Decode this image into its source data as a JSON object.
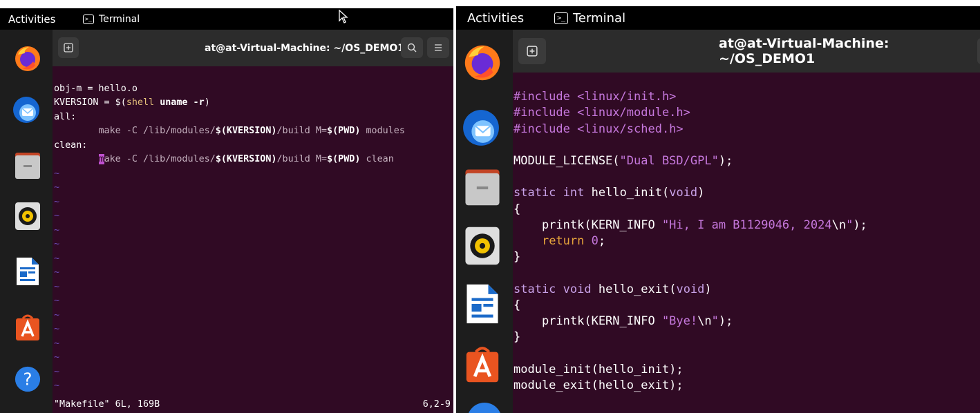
{
  "left_screenshot": {
    "topbar": {
      "activities": "Activities",
      "app": "Terminal"
    },
    "window": {
      "title": "at@at-Virtual-Machine: ~/OS_DEMO1",
      "new_tab_icon": "new-tab-icon",
      "search_icon": "search-icon",
      "menu_icon": "hamburger-menu-icon"
    },
    "dock": [
      "firefox-icon",
      "thunderbird-icon",
      "files-icon",
      "rhythmbox-icon",
      "writer-icon",
      "app-center-icon",
      "help-icon"
    ],
    "editor": {
      "line1": "obj-m = hello.o",
      "line2_a": "KVERSION = $(",
      "line2_b": "shell",
      "line2_c": " ",
      "line2_d": "uname -r",
      "line2_e": ")",
      "line3": "all:",
      "line4_a": "        make -C /lib/modules/",
      "line4_b": "$(KVERSION)",
      "line4_c": "/build M=",
      "line4_d": "$(PWD)",
      "line4_e": " modules",
      "line5": "clean:",
      "line6_a": "        ",
      "line6_cursor": "m",
      "line6_b": "ake -C /lib/modules/",
      "line6_c": "$(KVERSION)",
      "line6_d": "/build M=",
      "line6_e": "$(PWD)",
      "line6_f": " clean",
      "tilde": "~",
      "status_left": "\"Makefile\" 6L, 169B",
      "status_right": "6,2-9"
    }
  },
  "right_screenshot": {
    "topbar": {
      "activities": "Activities",
      "app": "Terminal"
    },
    "window": {
      "title": "at@at-Virtual-Machine: ~/OS_DEMO1",
      "new_tab_icon": "new-tab-icon"
    },
    "dock": [
      "firefox-icon",
      "thunderbird-icon",
      "files-icon",
      "rhythmbox-icon",
      "writer-icon",
      "app-center-icon"
    ],
    "code": {
      "inc1_a": "#include ",
      "inc1_b": "<linux/init.h>",
      "inc2_a": "#include ",
      "inc2_b": "<linux/module.h>",
      "inc3_a": "#include ",
      "inc3_b": "<linux/sched.h>",
      "lic_a": "MODULE_LICENSE(",
      "lic_b": "\"Dual BSD/GPL\"",
      "lic_c": ");",
      "init_a": "static",
      "init_b": " ",
      "init_c": "int",
      "init_d": " hello_init(",
      "init_e": "void",
      "init_f": ")",
      "brace_open": "{",
      "pk1_a": "    printk(KERN_INFO ",
      "pk1_b": "\"Hi, I am B1129046, 2024",
      "pk1_c": "\\n",
      "pk1_d": "\"",
      "pk1_e": ");",
      "ret_a": "    ",
      "ret_b": "return",
      "ret_c": " ",
      "ret_d": "0",
      "ret_e": ";",
      "brace_close": "}",
      "exit_a": "static",
      "exit_b": " ",
      "exit_c": "void",
      "exit_d": " hello_exit(",
      "exit_e": "void",
      "exit_f": ")",
      "pk2_a": "    printk(KERN_INFO ",
      "pk2_b": "\"Bye!",
      "pk2_c": "\\n",
      "pk2_d": "\"",
      "pk2_e": ");",
      "mi": "module_init(hello_init);",
      "me": "module_exit(hello_exit);",
      "tilde": "~"
    }
  }
}
